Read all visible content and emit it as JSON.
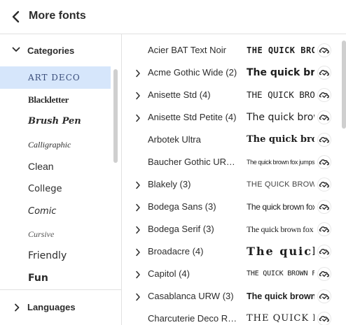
{
  "header": {
    "title": "More fonts"
  },
  "categories": {
    "label": "Categories",
    "items": [
      {
        "label": "ART DECO",
        "selected": true
      },
      {
        "label": "Blackletter"
      },
      {
        "label": "Brush Pen"
      },
      {
        "label": "Calligraphic"
      },
      {
        "label": "Clean"
      },
      {
        "label": "College"
      },
      {
        "label": "Comic"
      },
      {
        "label": "Cursive"
      },
      {
        "label": "Friendly"
      },
      {
        "label": "Fun"
      }
    ]
  },
  "languages": {
    "label": "Languages"
  },
  "fonts": [
    {
      "name": "Acier BAT Text Noir",
      "preview": "THE QUICK BROWN FOX",
      "expandable": false
    },
    {
      "name": "Acme Gothic Wide (2)",
      "preview": "The quick brown fox",
      "expandable": true
    },
    {
      "name": "Anisette Std (4)",
      "preview": "THE QUICK BROWN FOX",
      "expandable": true
    },
    {
      "name": "Anisette Std Petite (4)",
      "preview": "The quick brown fox",
      "expandable": true
    },
    {
      "name": "Arbotek Ultra",
      "preview": "The quick brown fox",
      "expandable": false
    },
    {
      "name": "Baucher Gothic URW...",
      "preview": "The quick brown fox jumps over the lazy dog",
      "expandable": false
    },
    {
      "name": "Blakely (3)",
      "preview": "THE QUICK BROWN FOX JUMPS",
      "expandable": true
    },
    {
      "name": "Bodega Sans (3)",
      "preview": "The quick brown fox jumps",
      "expandable": true
    },
    {
      "name": "Bodega Serif (3)",
      "preview": "The quick brown fox jumps",
      "expandable": true
    },
    {
      "name": "Broadacre (4)",
      "preview": "The quick brown",
      "expandable": true
    },
    {
      "name": "Capitol (4)",
      "preview": "THE QUICK BROWN FOX JUMPS",
      "expandable": true
    },
    {
      "name": "Casablanca URW (3)",
      "preview": "The quick brown fox",
      "expandable": true
    },
    {
      "name": "Charcuterie Deco Re...",
      "preview": "THE QUICK BROWN",
      "expandable": false
    }
  ],
  "colors": {
    "selected_bg": "#d6e6fb",
    "cc_icon": "#2c2c2c",
    "divider": "#e1e1e1"
  },
  "icons": {
    "back": "chevron-left-icon",
    "categories_toggle": "chevron-down-icon",
    "languages_toggle": "chevron-right-icon",
    "font_source": "creative-cloud-icon"
  }
}
